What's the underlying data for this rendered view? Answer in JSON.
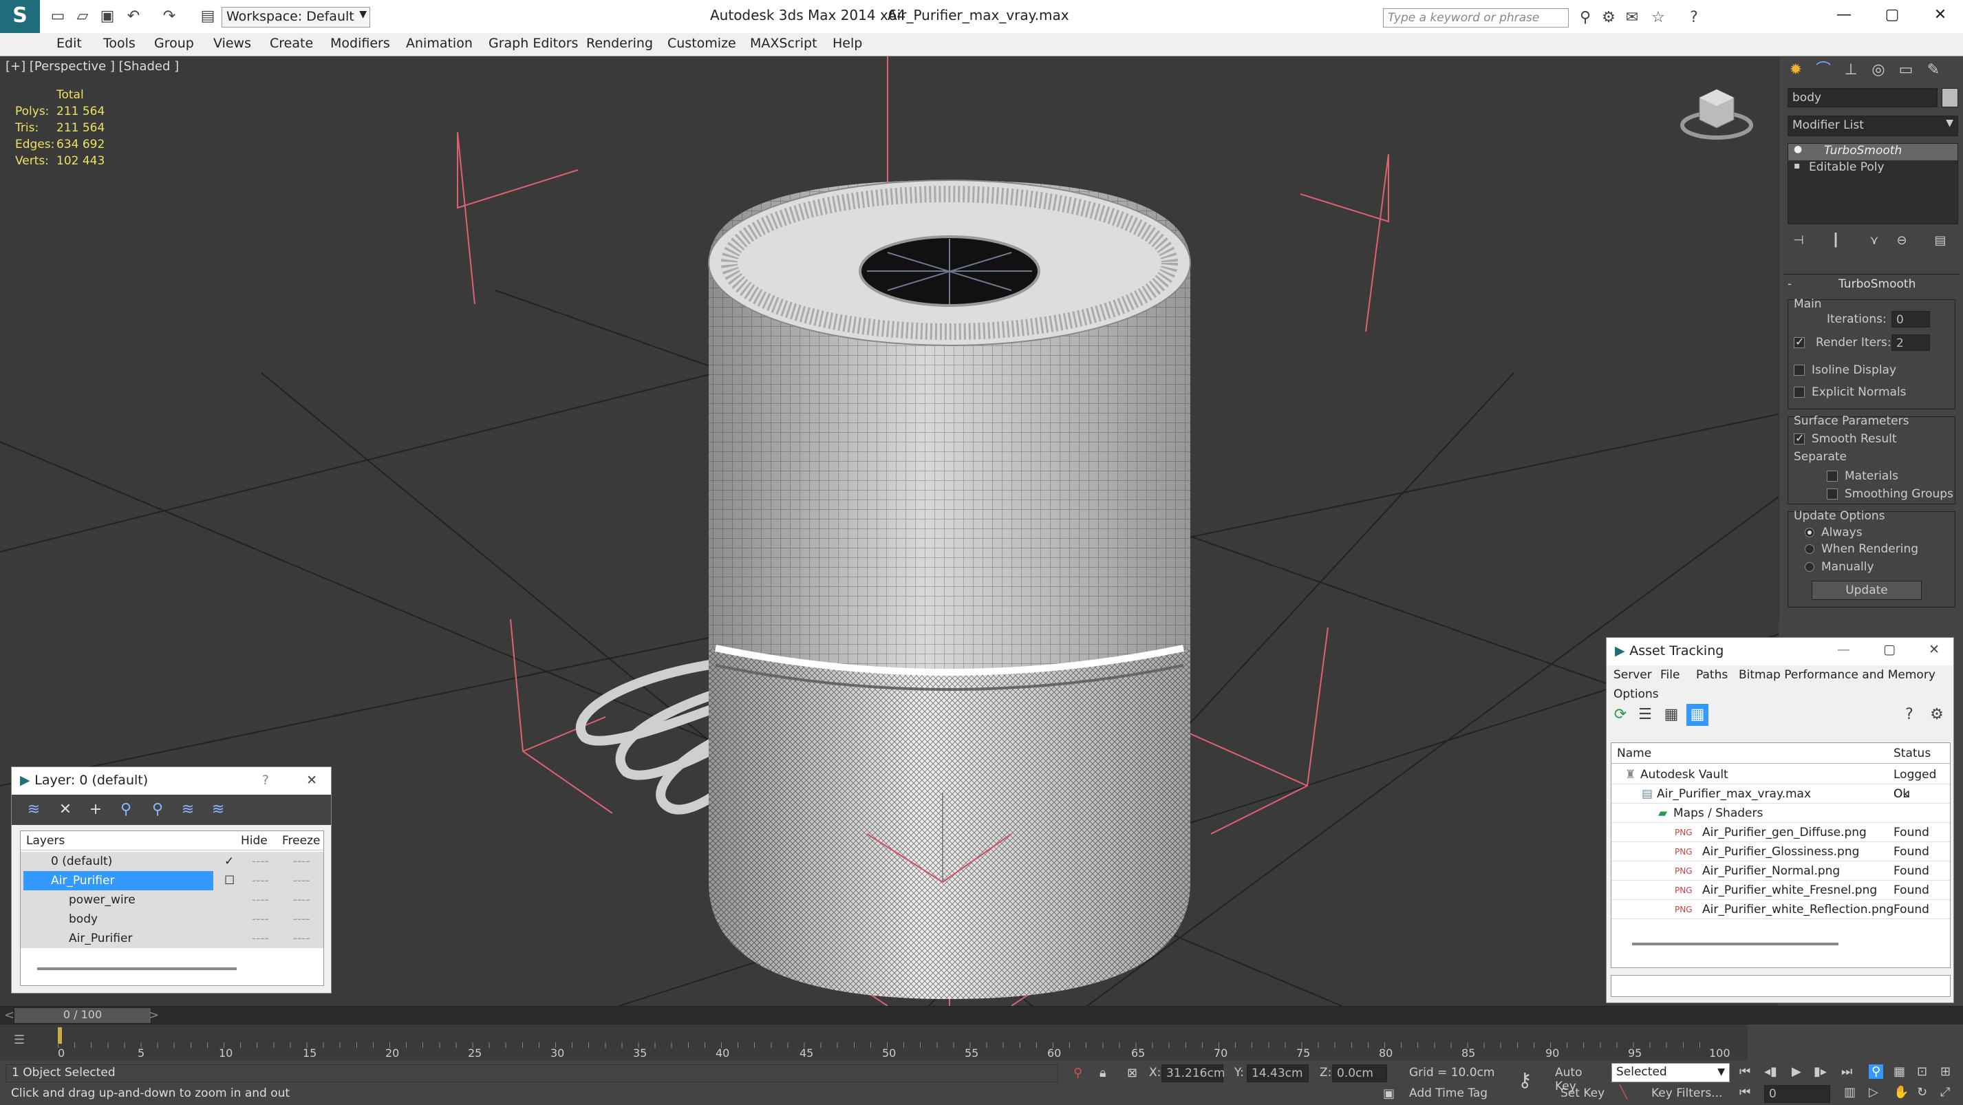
{
  "title": {
    "app": "Autodesk 3ds Max  2014 x64",
    "file": "Air_Purifier_max_vray.max",
    "workspace": "Workspace: Default",
    "search_placeholder": "Type a keyword or phrase"
  },
  "menu": [
    "Edit",
    "Tools",
    "Group",
    "Views",
    "Create",
    "Modifiers",
    "Animation",
    "Graph Editors",
    "Rendering",
    "Customize",
    "MAXScript",
    "Help"
  ],
  "viewport": {
    "label": "[+] [Perspective ] [Shaded ]",
    "stats": {
      "header": "Total",
      "polys_l": "Polys:",
      "polys": "211 564",
      "tris_l": "Tris:",
      "tris": "211 564",
      "edges_l": "Edges:",
      "edges": "634 692",
      "verts_l": "Verts:",
      "verts": "102 443"
    }
  },
  "cmd": {
    "object_name": "body",
    "modifier_list": "Modifier List",
    "stack": [
      "TurboSmooth",
      "Editable Poly"
    ],
    "rollout": "TurboSmooth",
    "main": "Main",
    "iterations_l": "Iterations:",
    "iterations": "0",
    "render_iters_l": "Render Iters:",
    "render_iters": "2",
    "isoline": "Isoline Display",
    "explicit": "Explicit Normals",
    "surface": "Surface Parameters",
    "smooth": "Smooth Result",
    "separate": "Separate",
    "materials": "Materials",
    "smoothing": "Smoothing Groups",
    "update_opts": "Update Options",
    "always": "Always",
    "when_rendering": "When Rendering",
    "manually": "Manually",
    "update_btn": "Update"
  },
  "layer": {
    "title": "Layer: 0 (default)",
    "help": "?",
    "col_layers": "Layers",
    "col_hide": "Hide",
    "col_freeze": "Freeze",
    "rows": [
      "0 (default)",
      "Air_Purifier",
      "power_wire",
      "body",
      "Air_Purifier"
    ],
    "dash": "----"
  },
  "asset": {
    "title": "Asset Tracking",
    "menu": [
      "Server",
      "File",
      "Paths",
      "Bitmap Performance and Memory",
      "Options"
    ],
    "col_name": "Name",
    "col_status": "Status",
    "rows": [
      {
        "name": "Autodesk Vault",
        "status": "Logged Ou"
      },
      {
        "name": "Air_Purifier_max_vray.max",
        "status": "Ok"
      },
      {
        "name": "Maps / Shaders",
        "status": ""
      },
      {
        "name": "Air_Purifier_gen_Diffuse.png",
        "status": "Found"
      },
      {
        "name": "Air_Purifier_Glossiness.png",
        "status": "Found"
      },
      {
        "name": "Air_Purifier_Normal.png",
        "status": "Found"
      },
      {
        "name": "Air_Purifier_white_Fresnel.png",
        "status": "Found"
      },
      {
        "name": "Air_Purifier_white_Reflection.png",
        "status": "Found"
      }
    ]
  },
  "timeline": {
    "frame": "0 / 100",
    "ticks": [
      "0",
      "5",
      "10",
      "15",
      "20",
      "25",
      "30",
      "35",
      "40",
      "45",
      "50",
      "55",
      "60",
      "65",
      "70",
      "75",
      "80",
      "85",
      "90",
      "95",
      "100"
    ],
    "status": "1 Object Selected",
    "prompt": "Click and drag up-and-down to zoom in and out",
    "x_l": "X:",
    "x": "31.216cm",
    "y_l": "Y:",
    "y": "14.43cm",
    "z_l": "Z:",
    "z": "0.0cm",
    "grid": "Grid = 10.0cm",
    "addtime": "Add Time Tag",
    "autokey": "Auto Key",
    "setkey": "Set Key",
    "selected": "Selected",
    "keyfilters": "Key Filters...",
    "frame_field": "0"
  },
  "colors": {
    "accent": "#3399ff",
    "stats": "#f0e060"
  }
}
